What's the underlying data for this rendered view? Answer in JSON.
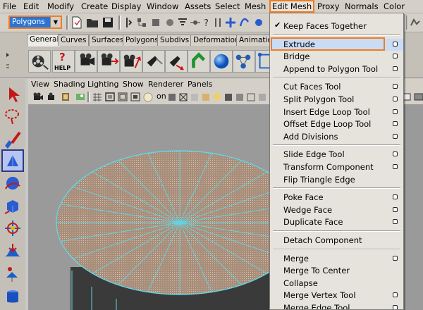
{
  "menubar": {
    "items": [
      "File",
      "Edit",
      "Modify",
      "Create",
      "Display",
      "Window",
      "Assets",
      "Select",
      "Mesh",
      "Edit Mesh",
      "Proxy",
      "Normals",
      "Color"
    ],
    "active": "Edit Mesh"
  },
  "status_line": {
    "mode": "Polygons"
  },
  "shelf": {
    "tabs": [
      "General",
      "Curves",
      "Surfaces",
      "Polygons",
      "Subdivs",
      "Deformation",
      "Animation"
    ],
    "active_tab": "General",
    "help_label": "HELP"
  },
  "panel": {
    "menu": [
      "View",
      "Shading",
      "Lighting",
      "Show",
      "Renderer",
      "Panels"
    ],
    "partial_text": "on"
  },
  "edit_mesh_menu": {
    "groups": [
      [
        {
          "label": "Keep Faces Together",
          "checked": true,
          "option": false
        }
      ],
      [
        {
          "label": "Extrude",
          "option": true,
          "highlighted": true
        },
        {
          "label": "Bridge",
          "option": true
        },
        {
          "label": "Append to Polygon Tool",
          "option": true
        }
      ],
      [
        {
          "label": "Cut Faces Tool",
          "option": true
        },
        {
          "label": "Split Polygon Tool",
          "option": true
        },
        {
          "label": "Insert Edge Loop Tool",
          "option": true
        },
        {
          "label": "Offset Edge Loop Tool",
          "option": true
        },
        {
          "label": "Add Divisions",
          "option": true
        }
      ],
      [
        {
          "label": "Slide Edge Tool",
          "option": true
        },
        {
          "label": "Transform Component",
          "option": true
        },
        {
          "label": "Flip Triangle Edge",
          "option": false
        }
      ],
      [
        {
          "label": "Poke Face",
          "option": true
        },
        {
          "label": "Wedge Face",
          "option": true
        },
        {
          "label": "Duplicate Face",
          "option": true
        }
      ],
      [
        {
          "label": "Detach Component",
          "option": false
        }
      ],
      [
        {
          "label": "Merge",
          "option": true
        },
        {
          "label": "Merge To Center",
          "option": false
        },
        {
          "label": "Collapse",
          "option": false
        },
        {
          "label": "Merge Vertex Tool",
          "option": true
        },
        {
          "label": "Merge Edge Tool",
          "option": true
        }
      ]
    ]
  },
  "colors": {
    "accent_orange": "#ef7d22",
    "selection_blue": "#2a74d4",
    "wireframe_cyan": "#5fd6e6",
    "face_brown": "#a88e7a"
  },
  "icons": {
    "toolbox": [
      "select-arrow-icon",
      "lasso-icon",
      "paint-select-icon",
      "move-icon",
      "rotate-icon",
      "scale-icon",
      "universal-manipulator-icon",
      "soft-mod-icon",
      "show-manipulator-icon",
      "last-tool-icon"
    ]
  }
}
